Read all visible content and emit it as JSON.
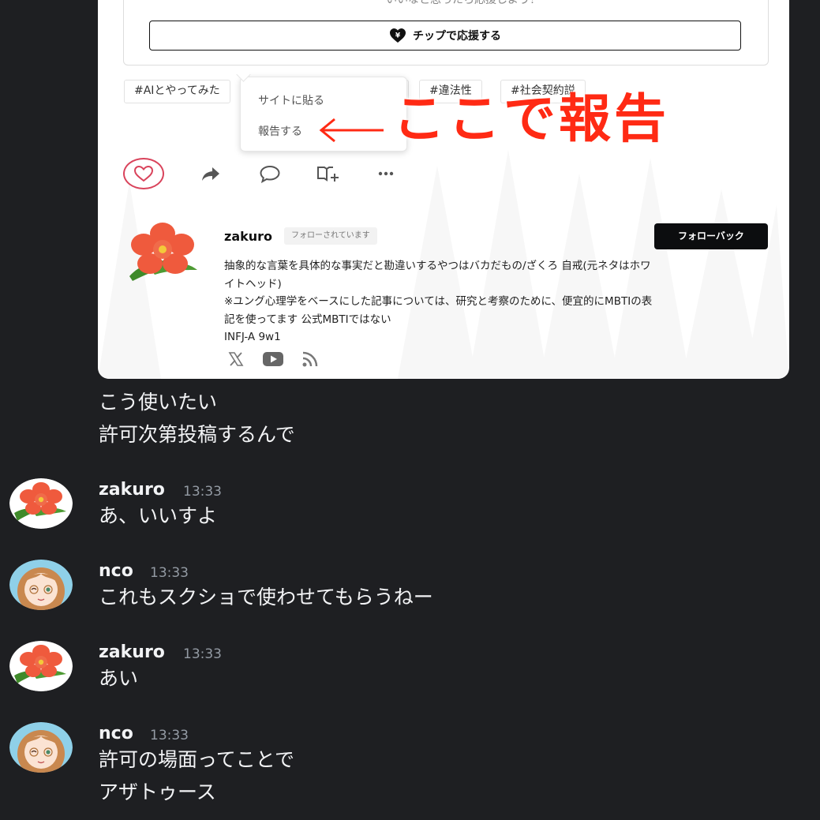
{
  "card": {
    "tip_caption": "いいなと思ったら応援しよう！",
    "tip_button": "チップで応援する",
    "tags": [
      "#AIとやってみた",
      "#違法性",
      "#社会契約説"
    ],
    "menu": {
      "item1": "サイトに貼る",
      "item2": "報告する"
    },
    "annotation": "ここで報告",
    "profile": {
      "name": "zakuro",
      "follow_status": "フォローされています",
      "follow_button": "フォローバック",
      "bio_lines": [
        "抽象的な言葉を具体的な事実だと勘違いするやつはバカだもの/ざくろ 自戒(元ネタはホワ",
        "イトヘッド)",
        "※ユング心理学をベースにした記事については、研究と考察のために、便宜的にMBTIの表",
        "記を使ってます 公式MBTIではない",
        "INFJ-A 9w1"
      ]
    },
    "accent_color": "#ff2a14",
    "like_color": "#d9435b"
  },
  "chat": {
    "continuation": [
      "こう使いたい",
      "許可次第投稿するんで"
    ],
    "messages": [
      {
        "author": "zakuro",
        "time": "13:33",
        "lines": [
          "あ、いいすよ"
        ]
      },
      {
        "author": "nco",
        "time": "13:33",
        "lines": [
          "これもスクショで使わせてもらうねー"
        ]
      },
      {
        "author": "zakuro",
        "time": "13:33",
        "lines": [
          "あい"
        ]
      },
      {
        "author": "nco",
        "time": "13:33",
        "lines": [
          "許可の場面ってことで",
          "アザトゥース"
        ]
      }
    ],
    "background_color": "#1e1f22"
  }
}
